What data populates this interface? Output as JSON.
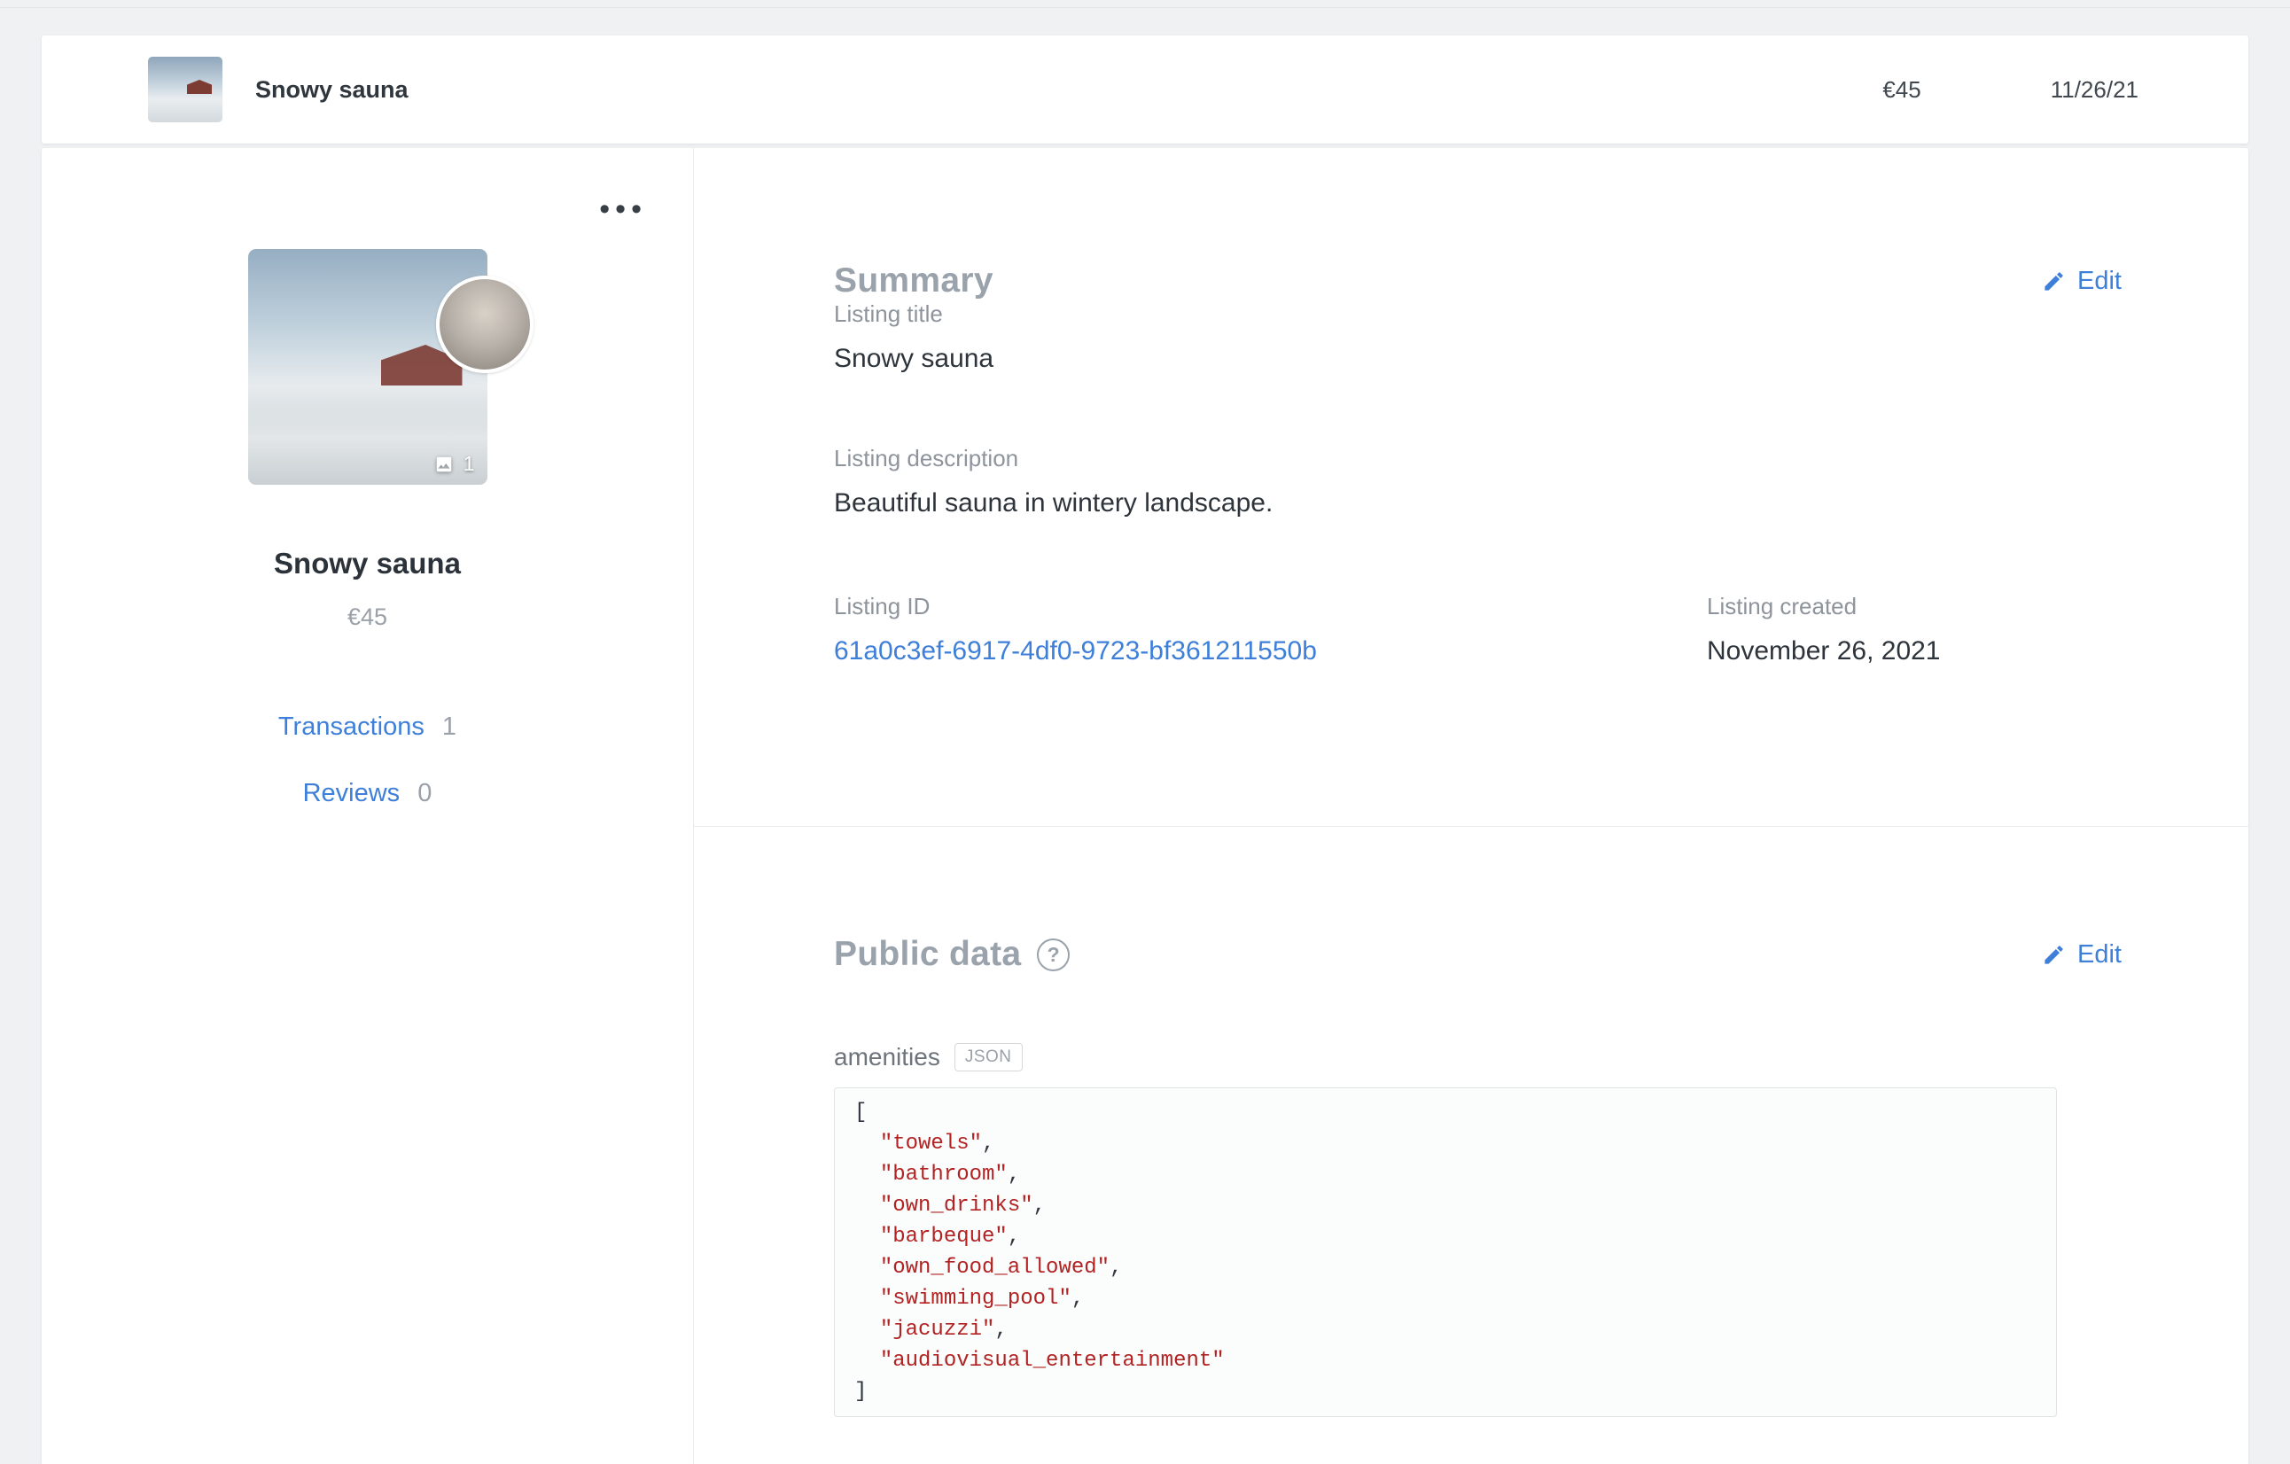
{
  "header": {
    "title": "Snowy sauna",
    "price": "€45",
    "date": "11/26/21"
  },
  "sidebar": {
    "menu_icon": "ellipsis",
    "image_count": "1",
    "title": "Snowy sauna",
    "price": "€45",
    "links": [
      {
        "label": "Transactions",
        "count": "1"
      },
      {
        "label": "Reviews",
        "count": "0"
      }
    ]
  },
  "summary": {
    "heading": "Summary",
    "edit_label": "Edit",
    "fields": [
      {
        "label": "Listing title",
        "value": "Snowy sauna"
      },
      {
        "label": "Listing description",
        "value": "Beautiful sauna in wintery landscape."
      }
    ],
    "listing_id_label": "Listing ID",
    "listing_id": "61a0c3ef-6917-4df0-9723-bf361211550b",
    "created_label": "Listing created",
    "created": "November 26, 2021"
  },
  "public_data": {
    "heading": "Public data",
    "help_icon": "?",
    "edit_label": "Edit",
    "field_label": "amenities",
    "field_type_badge": "JSON",
    "json_open": "[",
    "json_close": "]",
    "items": [
      "towels",
      "bathroom",
      "own_drinks",
      "barbeque",
      "own_food_allowed",
      "swimming_pool",
      "jacuzzi",
      "audiovisual_entertainment"
    ]
  },
  "colors": {
    "link": "#3d7fd9",
    "code_string": "#b22222"
  }
}
